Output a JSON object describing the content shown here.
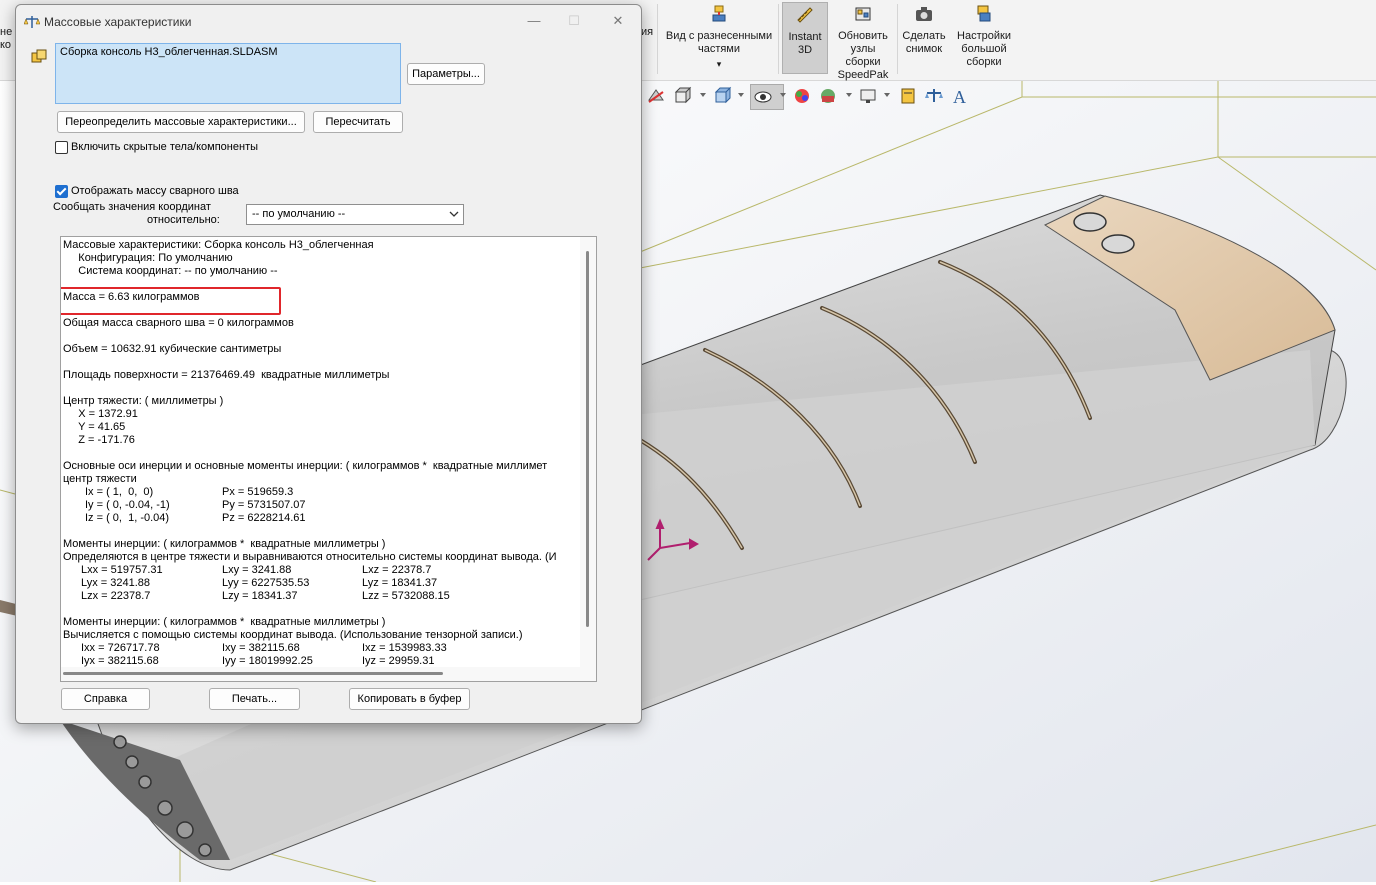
{
  "ribbon": {
    "partial_left": [
      "не",
      "ко"
    ],
    "partial_ia": "ия",
    "exploded_view": "Вид с разнесенными частями",
    "instant3d": [
      "Instant",
      "3D"
    ],
    "update_speedpak": [
      "Обновить",
      "узлы",
      "сборки",
      "SpeedPak"
    ],
    "snapshot": [
      "Сделать",
      "снимок"
    ],
    "large_assembly": [
      "Настройки",
      "большой",
      "сборки"
    ]
  },
  "dialog": {
    "title": "Массовые характеристики",
    "file": "Сборка консоль Н3_облегченная.SLDASM",
    "options_button": "Параметры...",
    "override_button": "Переопределить массовые характеристики...",
    "recalc_button": "Пересчитать",
    "include_hidden": "Включить скрытые тела/компоненты",
    "include_hidden_checked": false,
    "show_weld_mass": "Отображать массу сварного шва",
    "show_weld_mass_checked": true,
    "report_coords_label_1": "Сообщать значения координат",
    "report_coords_label_2": "относительно:",
    "coord_system_value": "-- по умолчанию --",
    "help_button": "Справка",
    "print_button": "Печать...",
    "copy_button": "Копировать в буфер"
  },
  "results": {
    "lines": [
      "Массовые характеристики: Сборка консоль Н3_облегченная",
      "     Конфигурация: По умолчанию",
      "     Система координат: -- по умолчанию --",
      "",
      "Масса = 6.63 килограммов",
      "",
      "Общая масса сварного шва = 0 килограммов",
      "",
      "Объем = 10632.91 кубические сантиметры",
      "",
      "Площадь поверхности = 21376469.49  квадратные миллиметры",
      "",
      "Центр тяжести: ( миллиметры )",
      "     X = 1372.91",
      "     Y = 41.65",
      "     Z = -171.76",
      "",
      "Основные оси инерции и основные моменты инерции: ( килограммов *  квадратные миллимет",
      "центр тяжести",
      "",
      "",
      "",
      "",
      "Моменты инерции: ( килограммов *  квадратные миллиметры )",
      "Определяются в центре тяжести и выравниваются относительно системы координат вывода. (И",
      "",
      "",
      "",
      "",
      "Моменты инерции: ( килограммов *  квадратные миллиметры )",
      "Вычисляется с помощью системы координат вывода. (Использование тензорной записи.)",
      "",
      ""
    ],
    "principal": [
      [
        "Ix = ( 1,  0,  0)",
        "Px = 519659.3"
      ],
      [
        "Iy = ( 0, -0.04, -1)",
        "Py = 5731507.07"
      ],
      [
        "Iz = ( 0,  1, -0.04)",
        "Pz = 6228214.61"
      ]
    ],
    "moments_cg": [
      [
        "Lxx = 519757.31",
        "Lxy = 3241.88",
        "Lxz = 22378.7"
      ],
      [
        "Lyx = 3241.88",
        "Lyy = 6227535.53",
        "Lyz = 18341.37"
      ],
      [
        "Lzx = 22378.7",
        "Lzy = 18341.37",
        "Lzz = 5732088.15"
      ]
    ],
    "moments_out": [
      [
        "Ixx = 726717.78",
        "Ixy = 382115.68",
        "Ixz = 1539983.33"
      ],
      [
        "Iyx = 382115.68",
        "Iyy = 18019992.25",
        "Iyz = 29959.31"
      ]
    ]
  }
}
